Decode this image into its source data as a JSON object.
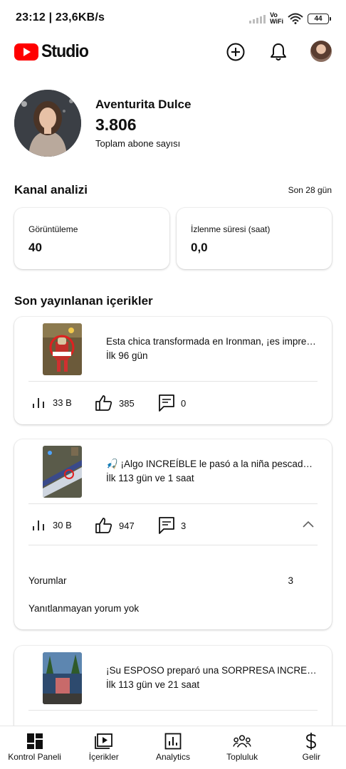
{
  "status_bar": {
    "time": "23:12 | 23,6KB/s",
    "network_label": "Vo\nWiFi",
    "battery": "44"
  },
  "header": {
    "logo_text": "Studio",
    "brand_color": "#ff0000",
    "icons": [
      "create-icon",
      "notifications-icon",
      "account-avatar"
    ]
  },
  "channel": {
    "name": "Aventurita Dulce",
    "subscribers": "3.806",
    "subscribers_label": "Toplam abone sayısı"
  },
  "analytics": {
    "title": "Kanal analizi",
    "period": "Son 28 gün",
    "cards": [
      {
        "label": "Görüntüleme",
        "value": "40"
      },
      {
        "label": "İzlenme süresi (saat)",
        "value": "0,0"
      }
    ]
  },
  "recent": {
    "title": "Son yayınlanan içerikler",
    "videos": [
      {
        "title": "Esta chica transformada en Ironman, ¡es impresionante!",
        "age": "İlk 96 gün",
        "views": "33 B",
        "likes": "385",
        "comments": "0"
      },
      {
        "title": "🎣 ¡Algo INCREÍBLE le pasó a la niña pescadora!",
        "age": "İlk 113 gün ve 1 saat",
        "views": "30 B",
        "likes": "947",
        "comments": "3",
        "expanded": {
          "comments_label": "Yorumlar",
          "comments_value": "3",
          "unanswered": "Yanıtlanmayan yorum yok"
        }
      },
      {
        "title": "¡Su ESPOSO preparó una SORPRESA INCREÍBLE!",
        "age": "İlk 113 gün ve 21 saat"
      }
    ]
  },
  "bottom_nav": [
    {
      "label": "Kontrol Paneli",
      "icon": "dashboard-icon"
    },
    {
      "label": "İçerikler",
      "icon": "content-icon"
    },
    {
      "label": "Analytics",
      "icon": "analytics-icon"
    },
    {
      "label": "Topluluk",
      "icon": "community-icon"
    },
    {
      "label": "Gelir",
      "icon": "earn-icon"
    }
  ]
}
